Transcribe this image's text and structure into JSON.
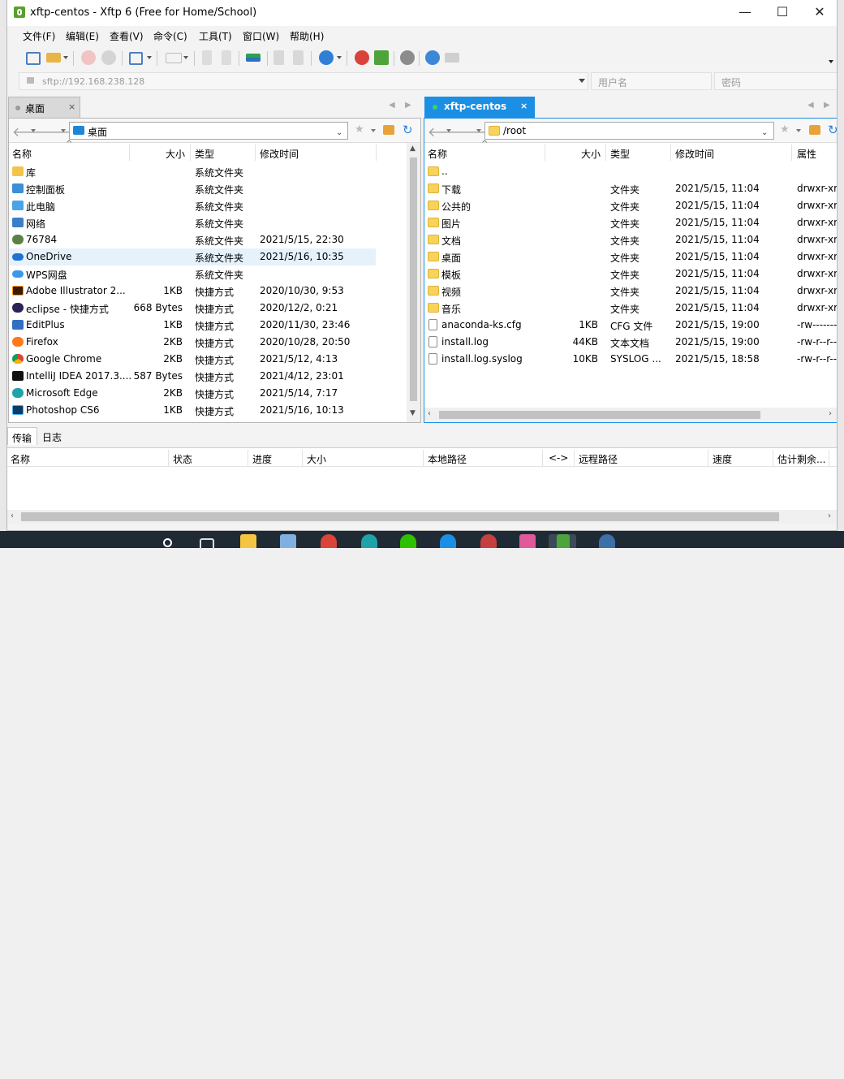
{
  "window": {
    "title": "xftp-centos - Xftp 6 (Free for Home/School)",
    "controls": {
      "minimize": "—",
      "maximize": "☐",
      "close": "✕"
    }
  },
  "menu": [
    "文件(F)",
    "编辑(E)",
    "查看(V)",
    "命令(C)",
    "工具(T)",
    "窗口(W)",
    "帮助(H)"
  ],
  "address": {
    "host": "sftp://192.168.238.128",
    "username_placeholder": "用户名",
    "password_placeholder": "密码"
  },
  "tabs": {
    "local": {
      "label": "桌面",
      "close": "×"
    },
    "remote": {
      "label": "xftp-centos",
      "close": "×"
    }
  },
  "local": {
    "path": "桌面",
    "columns": [
      "名称",
      "大小",
      "类型",
      "修改时间"
    ],
    "rows": [
      {
        "name": "库",
        "size": "",
        "type": "系统文件夹",
        "mtime": "",
        "icon": "library-icon"
      },
      {
        "name": "控制面板",
        "size": "",
        "type": "系统文件夹",
        "mtime": "",
        "icon": "control-panel-icon"
      },
      {
        "name": "此电脑",
        "size": "",
        "type": "系统文件夹",
        "mtime": "",
        "icon": "computer-icon"
      },
      {
        "name": "网络",
        "size": "",
        "type": "系统文件夹",
        "mtime": "",
        "icon": "network-icon"
      },
      {
        "name": "76784",
        "size": "",
        "type": "系统文件夹",
        "mtime": "2021/5/15, 22:30",
        "icon": "user-icon"
      },
      {
        "name": "OneDrive",
        "size": "",
        "type": "系统文件夹",
        "mtime": "2021/5/16, 10:35",
        "icon": "onedrive-icon"
      },
      {
        "name": "WPS网盘",
        "size": "",
        "type": "系统文件夹",
        "mtime": "",
        "icon": "wps-cloud-icon"
      },
      {
        "name": "Adobe Illustrator 2...",
        "size": "1KB",
        "type": "快捷方式",
        "mtime": "2020/10/30, 9:53",
        "icon": "illustrator-icon"
      },
      {
        "name": "eclipse - 快捷方式",
        "size": "668 Bytes",
        "type": "快捷方式",
        "mtime": "2020/12/2, 0:21",
        "icon": "eclipse-icon"
      },
      {
        "name": "EditPlus",
        "size": "1KB",
        "type": "快捷方式",
        "mtime": "2020/11/30, 23:46",
        "icon": "editplus-icon"
      },
      {
        "name": "Firefox",
        "size": "2KB",
        "type": "快捷方式",
        "mtime": "2020/10/28, 20:50",
        "icon": "firefox-icon"
      },
      {
        "name": "Google Chrome",
        "size": "2KB",
        "type": "快捷方式",
        "mtime": "2021/5/12, 4:13",
        "icon": "chrome-icon"
      },
      {
        "name": "IntelliJ IDEA 2017.3....",
        "size": "587 Bytes",
        "type": "快捷方式",
        "mtime": "2021/4/12, 23:01",
        "icon": "intellij-icon"
      },
      {
        "name": "Microsoft Edge",
        "size": "2KB",
        "type": "快捷方式",
        "mtime": "2021/5/14, 7:17",
        "icon": "edge-icon"
      },
      {
        "name": "Photoshop CS6",
        "size": "1KB",
        "type": "快捷方式",
        "mtime": "2021/5/16, 10:13",
        "icon": "photoshop-icon"
      }
    ]
  },
  "remote": {
    "path": "/root",
    "columns": [
      "名称",
      "大小",
      "类型",
      "修改时间",
      "属性"
    ],
    "rows": [
      {
        "name": "..",
        "size": "",
        "type": "",
        "mtime": "",
        "attr": "",
        "icon": "folder-icon"
      },
      {
        "name": "下载",
        "size": "",
        "type": "文件夹",
        "mtime": "2021/5/15, 11:04",
        "attr": "drwxr-xr-x",
        "icon": "folder-icon"
      },
      {
        "name": "公共的",
        "size": "",
        "type": "文件夹",
        "mtime": "2021/5/15, 11:04",
        "attr": "drwxr-xr-x",
        "icon": "folder-icon"
      },
      {
        "name": "图片",
        "size": "",
        "type": "文件夹",
        "mtime": "2021/5/15, 11:04",
        "attr": "drwxr-xr-x",
        "icon": "folder-icon"
      },
      {
        "name": "文档",
        "size": "",
        "type": "文件夹",
        "mtime": "2021/5/15, 11:04",
        "attr": "drwxr-xr-x",
        "icon": "folder-icon"
      },
      {
        "name": "桌面",
        "size": "",
        "type": "文件夹",
        "mtime": "2021/5/15, 11:04",
        "attr": "drwxr-xr-x",
        "icon": "folder-icon"
      },
      {
        "name": "模板",
        "size": "",
        "type": "文件夹",
        "mtime": "2021/5/15, 11:04",
        "attr": "drwxr-xr-x",
        "icon": "folder-icon"
      },
      {
        "name": "视频",
        "size": "",
        "type": "文件夹",
        "mtime": "2021/5/15, 11:04",
        "attr": "drwxr-xr-x",
        "icon": "folder-icon"
      },
      {
        "name": "音乐",
        "size": "",
        "type": "文件夹",
        "mtime": "2021/5/15, 11:04",
        "attr": "drwxr-xr-x",
        "icon": "folder-icon"
      },
      {
        "name": "anaconda-ks.cfg",
        "size": "1KB",
        "type": "CFG 文件",
        "mtime": "2021/5/15, 19:00",
        "attr": "-rw-------",
        "icon": "file-icon"
      },
      {
        "name": "install.log",
        "size": "44KB",
        "type": "文本文档",
        "mtime": "2021/5/15, 19:00",
        "attr": "-rw-r--r--",
        "icon": "file-icon"
      },
      {
        "name": "install.log.syslog",
        "size": "10KB",
        "type": "SYSLOG ...",
        "mtime": "2021/5/15, 18:58",
        "attr": "-rw-r--r--",
        "icon": "file-icon"
      }
    ]
  },
  "transfer": {
    "tabs": [
      "传输",
      "日志"
    ],
    "columns": [
      "名称",
      "状态",
      "进度",
      "大小",
      "本地路径",
      "<->",
      "远程路径",
      "速度",
      "估计剩余..."
    ]
  },
  "colors": {
    "accent": "#1a8fe3",
    "selection": "#e5f1fb",
    "folder": "#f8d35b"
  }
}
